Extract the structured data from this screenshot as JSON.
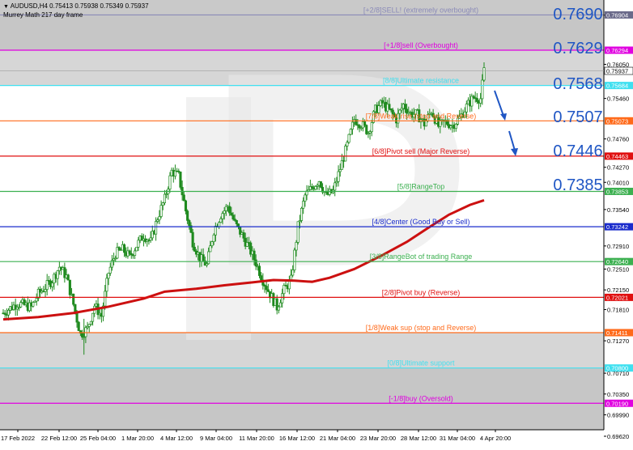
{
  "header": {
    "symbol_line": "AUDUSD,H4 0.75413 0.75938 0.75349 0.75937",
    "indicator_line": "Murrey Math 217 day frame"
  },
  "chart_data": {
    "type": "candlestick",
    "symbol": "AUDUSD",
    "timeframe": "H4",
    "ohlc_last": {
      "open": 0.75413,
      "high": 0.75938,
      "low": 0.75349,
      "close": 0.75937
    },
    "ylim": [
      0.6962,
      0.7705
    ],
    "y_ticks": [
      "0.76900",
      "0.76050",
      "0.75460",
      "0.74760",
      "0.74270",
      "0.74010",
      "0.73540",
      "0.72910",
      "0.72510",
      "0.72150",
      "0.71810",
      "0.71270",
      "0.70710",
      "0.70350",
      "0.69990",
      "0.69620"
    ],
    "x_ticks": [
      "17 Feb 2022",
      "22 Feb 12:00",
      "25 Feb 04:00",
      "1 Mar 20:00",
      "4 Mar 12:00",
      "9 Mar 04:00",
      "11 Mar 20:00",
      "16 Mar 12:00",
      "21 Mar 04:00",
      "23 Mar 20:00",
      "28 Mar 12:00",
      "31 Mar 04:00",
      "4 Apr 20:00"
    ],
    "price_tag": "0.75937",
    "murrey_levels": [
      {
        "value": 0.76904,
        "tag": "0.76904",
        "label": "[+2/8]SELL! (extremely overbought)",
        "color": "#8a8ab8",
        "tag_color": "#6a6a8a"
      },
      {
        "value": 0.76294,
        "tag": "0.76294",
        "label": "[+1/8]sell (Overbought)",
        "color": "#e000e0",
        "tag_color": "#e000e0"
      },
      {
        "value": 0.75684,
        "tag": "0.75684",
        "label": "[8/8]Ultimate resistance",
        "color": "#40e0f0",
        "tag_color": "#40e0f0"
      },
      {
        "value": 0.75073,
        "tag": "0.75073",
        "label": "[7/8]Weak rise (stop and Reverse)",
        "color": "#ff6a1a",
        "tag_color": "#ff6a1a"
      },
      {
        "value": 0.74463,
        "tag": "0.74463",
        "label": "[6/8]Pivot sell (Major Reverse)",
        "color": "#e01010",
        "tag_color": "#e01010"
      },
      {
        "value": 0.73853,
        "tag": "0.73853",
        "label": "[5/8]RangeTop",
        "color": "#3cb050",
        "tag_color": "#3cb050"
      },
      {
        "value": 0.73242,
        "tag": "0.73242",
        "label": "[4/8]Center (Good Buy or Sell)",
        "color": "#1a2ccc",
        "tag_color": "#1a2ccc"
      },
      {
        "value": 0.7264,
        "tag": "0.72640",
        "label": "[3/8]RangeBot of trading Range",
        "color": "#3cb050",
        "tag_color": "#3cb050"
      },
      {
        "value": 0.72021,
        "tag": "0.72021",
        "label": "[2/8]Pivot buy (Reverse)",
        "color": "#e01010",
        "tag_color": "#e01010"
      },
      {
        "value": 0.71411,
        "tag": "0.71411",
        "label": "[1/8]Weak sup (stop and Reverse)",
        "color": "#ff6a1a",
        "tag_color": "#ff6a1a"
      },
      {
        "value": 0.708,
        "tag": "0.70800",
        "label": "[0/8]Ultimate support",
        "color": "#40e0f0",
        "tag_color": "#40e0f0"
      },
      {
        "value": 0.7019,
        "tag": "0.70190",
        "label": "[-1/8]buy (Oversold)",
        "color": "#e000e0",
        "tag_color": "#e000e0"
      }
    ],
    "annotations": [
      {
        "text": "0.7690",
        "value": 0.769
      },
      {
        "text": "0.7629",
        "value": 0.7629
      },
      {
        "text": "0.7568",
        "value": 0.7568
      },
      {
        "text": "0.7507",
        "value": 0.7507
      },
      {
        "text": "0.7446",
        "value": 0.7446
      },
      {
        "text": "0.7385",
        "value": 0.7385
      }
    ],
    "moving_average": {
      "color": "#cc1010",
      "points": [
        [
          0,
          0.7164
        ],
        [
          10,
          0.7168
        ],
        [
          20,
          0.7175
        ],
        [
          30,
          0.7186
        ],
        [
          40,
          0.72
        ],
        [
          46,
          0.7212
        ],
        [
          55,
          0.7217
        ],
        [
          63,
          0.7223
        ],
        [
          71,
          0.7228
        ],
        [
          77,
          0.7232
        ],
        [
          83,
          0.7231
        ],
        [
          88,
          0.7229
        ],
        [
          93,
          0.7236
        ],
        [
          100,
          0.7251
        ],
        [
          108,
          0.7275
        ],
        [
          115,
          0.7298
        ],
        [
          121,
          0.7322
        ],
        [
          127,
          0.7345
        ],
        [
          133,
          0.7362
        ],
        [
          137,
          0.737
        ]
      ]
    },
    "close_path": [
      [
        0,
        0.7175
      ],
      [
        4,
        0.7192
      ],
      [
        8,
        0.7185
      ],
      [
        10,
        0.7208
      ],
      [
        14,
        0.7232
      ],
      [
        16,
        0.7255
      ],
      [
        18,
        0.7238
      ],
      [
        20,
        0.719
      ],
      [
        22,
        0.7138
      ],
      [
        24,
        0.7148
      ],
      [
        26,
        0.7188
      ],
      [
        28,
        0.717
      ],
      [
        30,
        0.7245
      ],
      [
        32,
        0.7278
      ],
      [
        34,
        0.7285
      ],
      [
        36,
        0.7272
      ],
      [
        38,
        0.7292
      ],
      [
        40,
        0.731
      ],
      [
        42,
        0.7298
      ],
      [
        44,
        0.734
      ],
      [
        46,
        0.7372
      ],
      [
        48,
        0.742
      ],
      [
        50,
        0.7412
      ],
      [
        52,
        0.7352
      ],
      [
        54,
        0.7298
      ],
      [
        56,
        0.727
      ],
      [
        58,
        0.7258
      ],
      [
        60,
        0.7318
      ],
      [
        62,
        0.7345
      ],
      [
        64,
        0.736
      ],
      [
        66,
        0.733
      ],
      [
        68,
        0.731
      ],
      [
        70,
        0.7288
      ],
      [
        72,
        0.7262
      ],
      [
        74,
        0.7232
      ],
      [
        76,
        0.7208
      ],
      [
        78,
        0.7185
      ],
      [
        80,
        0.7215
      ],
      [
        82,
        0.7232
      ],
      [
        84,
        0.7325
      ],
      [
        86,
        0.7378
      ],
      [
        88,
        0.7392
      ],
      [
        90,
        0.7405
      ],
      [
        92,
        0.7378
      ],
      [
        94,
        0.7385
      ],
      [
        96,
        0.7425
      ],
      [
        98,
        0.7465
      ],
      [
        100,
        0.751
      ],
      [
        102,
        0.7502
      ],
      [
        104,
        0.7488
      ],
      [
        106,
        0.7526
      ],
      [
        108,
        0.7538
      ],
      [
        110,
        0.7525
      ],
      [
        112,
        0.751
      ],
      [
        114,
        0.7535
      ],
      [
        116,
        0.752
      ],
      [
        118,
        0.7518
      ],
      [
        120,
        0.7502
      ],
      [
        122,
        0.7525
      ],
      [
        124,
        0.7498
      ],
      [
        126,
        0.7505
      ],
      [
        128,
        0.75
      ],
      [
        130,
        0.7512
      ],
      [
        132,
        0.7532
      ],
      [
        134,
        0.7548
      ],
      [
        136,
        0.7546
      ],
      [
        137,
        0.75937
      ]
    ],
    "wick_seed": 7
  }
}
